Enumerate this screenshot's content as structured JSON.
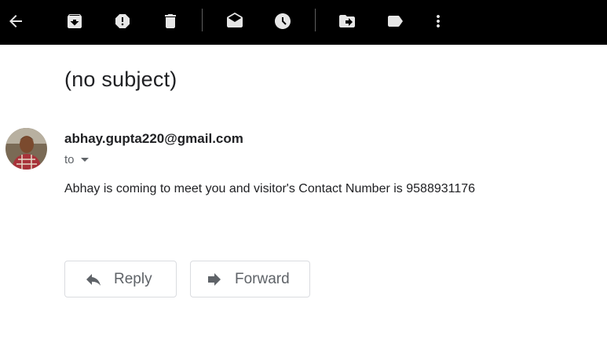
{
  "toolbar": {
    "icons": [
      "back-arrow-icon",
      "archive-icon",
      "report-spam-icon",
      "delete-icon",
      "mark-unread-icon",
      "snooze-icon",
      "move-to-icon",
      "label-icon",
      "more-options-icon"
    ],
    "background": "#000000",
    "icon_color": "#e6e6e6"
  },
  "email": {
    "subject": "(no subject)",
    "sender": "abhay.gupta220@gmail.com",
    "to_label": "to",
    "body": "Abhay is coming to meet you and visitor's Contact Number is 9588931176"
  },
  "actions": {
    "reply_label": "Reply",
    "forward_label": "Forward"
  }
}
